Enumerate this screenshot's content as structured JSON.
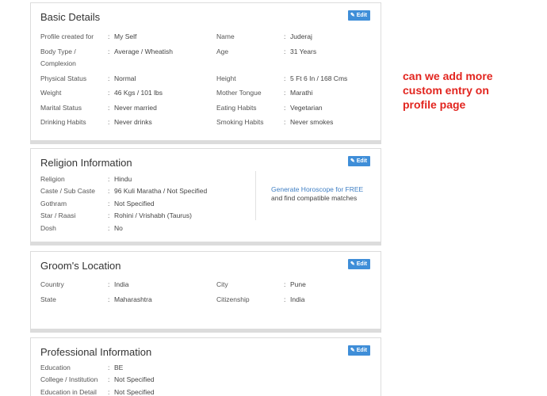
{
  "basic": {
    "title": "Basic Details",
    "edit": "Edit",
    "left": [
      {
        "label": "Profile created for",
        "value": "My Self"
      },
      {
        "label": "Body Type /",
        "label2": "Complexion",
        "value": "Average / Wheatish"
      },
      {
        "label": "Physical Status",
        "value": "Normal"
      },
      {
        "label": "Weight",
        "value": "46 Kgs / 101 lbs"
      },
      {
        "label": "Marital Status",
        "value": "Never married"
      },
      {
        "label": "Drinking Habits",
        "value": "Never drinks"
      }
    ],
    "right": [
      {
        "label": "Name",
        "value": "Juderaj"
      },
      {
        "label": "Age",
        "value": "31 Years"
      },
      {
        "label": "Height",
        "value": "5 Ft 6 In / 168 Cms"
      },
      {
        "label": "Mother Tongue",
        "value": "Marathi"
      },
      {
        "label": "Eating Habits",
        "value": "Vegetarian"
      },
      {
        "label": "Smoking Habits",
        "value": "Never smokes"
      }
    ]
  },
  "religion": {
    "title": "Religion Information",
    "edit": "Edit",
    "rows": [
      {
        "label": "Religion",
        "value": "Hindu"
      },
      {
        "label": "Caste / Sub Caste",
        "value": "96 Kuli Maratha / Not Specified"
      },
      {
        "label": "Gothram",
        "value": "Not Specified"
      },
      {
        "label": "Star / Raasi",
        "value": "Rohini / Vrishabh (Taurus)"
      },
      {
        "label": "Dosh",
        "value": "No"
      }
    ],
    "horoscope_link": "Generate Horoscope for FREE",
    "horoscope_sub": "and find compatible matches"
  },
  "location": {
    "title": "Groom's Location",
    "edit": "Edit",
    "left": [
      {
        "label": "Country",
        "value": "India"
      },
      {
        "label": "State",
        "value": "Maharashtra"
      }
    ],
    "right": [
      {
        "label": "City",
        "value": "Pune"
      },
      {
        "label": "Citizenship",
        "value": "India"
      }
    ]
  },
  "professional": {
    "title": "Professional Information",
    "edit": "Edit",
    "rows": [
      {
        "label": "Education",
        "value": "BE"
      },
      {
        "label": "College / Institution",
        "value": "Not Specified"
      },
      {
        "label": "Education in Detail",
        "value": "Not Specified"
      }
    ]
  },
  "colon": ":",
  "note": "can we add more custom entry on profile page",
  "colors": {
    "accent": "#3f8ed8",
    "note": "#e2251f",
    "link": "#3f7fc4"
  }
}
